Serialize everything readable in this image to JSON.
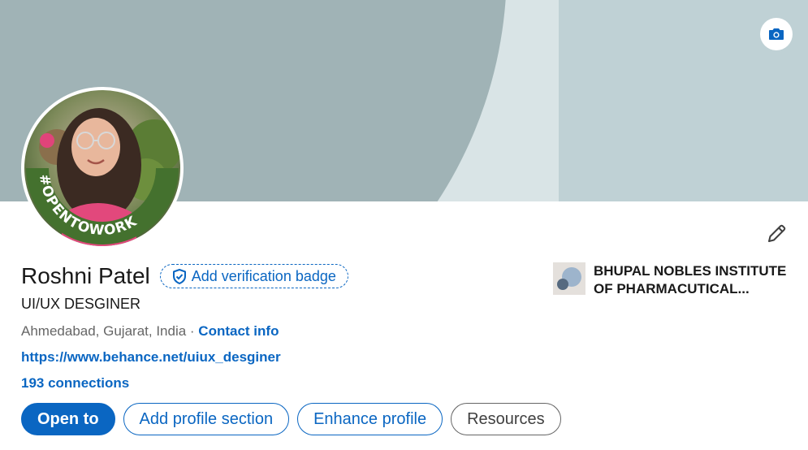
{
  "profile": {
    "name": "Roshni Patel",
    "verification_label": "Add verification badge",
    "headline": "UI/UX DESGINER",
    "location": "Ahmedabad, Gujarat, India",
    "separator": " · ",
    "contact_info": "Contact info",
    "website": "https://www.behance.net/uiux_desginer",
    "connections": "193 connections",
    "open_to_work_frame": "#OPENTOWORK"
  },
  "education": {
    "line1": "BHUPAL NOBLES INSTITUTE",
    "line2": "OF PHARMACUTICAL..."
  },
  "actions": {
    "open_to": "Open to",
    "add_section": "Add profile section",
    "enhance": "Enhance profile",
    "resources": "Resources"
  },
  "icons": {
    "banner_camera": "camera-icon",
    "edit_intro": "pencil-icon",
    "verify": "shield-check-icon"
  },
  "colors": {
    "accent": "#0a66c2",
    "banner_light": "#d9e4e6",
    "banner_dark": "#a0b3b6",
    "open_to_work_green": "#44712e"
  }
}
